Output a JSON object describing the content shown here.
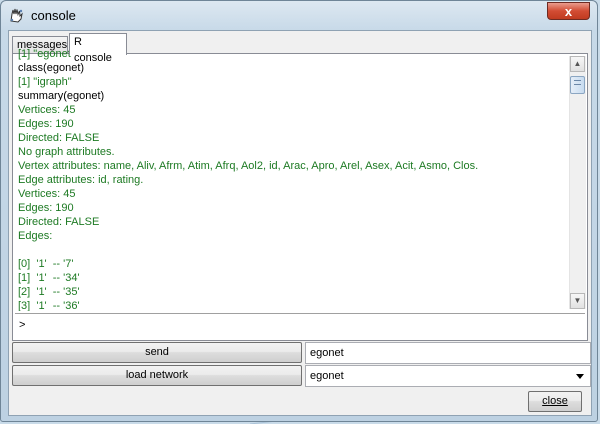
{
  "window": {
    "title": "console",
    "close_glyph": "x"
  },
  "tabs": [
    {
      "label": "messages",
      "active": false
    },
    {
      "label": "R console",
      "active": true
    }
  ],
  "console": {
    "lines": [
      {
        "text": "[1] \"egonet\"",
        "kind": "out"
      },
      {
        "text": "class(egonet)",
        "kind": "cmd"
      },
      {
        "text": "[1] \"igraph\"",
        "kind": "out"
      },
      {
        "text": "summary(egonet)",
        "kind": "cmd"
      },
      {
        "text": "Vertices: 45",
        "kind": "out"
      },
      {
        "text": "Edges: 190",
        "kind": "out"
      },
      {
        "text": "Directed: FALSE",
        "kind": "out"
      },
      {
        "text": "No graph attributes.",
        "kind": "out"
      },
      {
        "text": "Vertex attributes: name, Aliv, Afrm, Atim, Afrq, Aol2, id, Arac, Apro, Arel, Asex, Acit, Asmo, Clos.",
        "kind": "out"
      },
      {
        "text": "Edge attributes: id, rating.",
        "kind": "out"
      },
      {
        "text": "Vertices: 45",
        "kind": "out"
      },
      {
        "text": "Edges: 190",
        "kind": "out"
      },
      {
        "text": "Directed: FALSE",
        "kind": "out"
      },
      {
        "text": "Edges:",
        "kind": "out"
      },
      {
        "text": "",
        "kind": "out"
      },
      {
        "text": "[0]  '1'  -- '7'",
        "kind": "out"
      },
      {
        "text": "[1]  '1'  -- '34'",
        "kind": "out"
      },
      {
        "text": "[2]  '1'  -- '35'",
        "kind": "out"
      },
      {
        "text": "[3]  '1'  -- '36'",
        "kind": "out"
      }
    ],
    "prompt": ">",
    "scroll_up_glyph": "▲",
    "scroll_down_glyph": "▼"
  },
  "actions": {
    "send_label": "send",
    "send_value": "egonet",
    "load_label": "load network",
    "load_selected": "egonet",
    "close_label": "close"
  },
  "colors": {
    "output_text": "#1d7a23",
    "command_text": "#000000",
    "close_button": "#c03b20"
  }
}
